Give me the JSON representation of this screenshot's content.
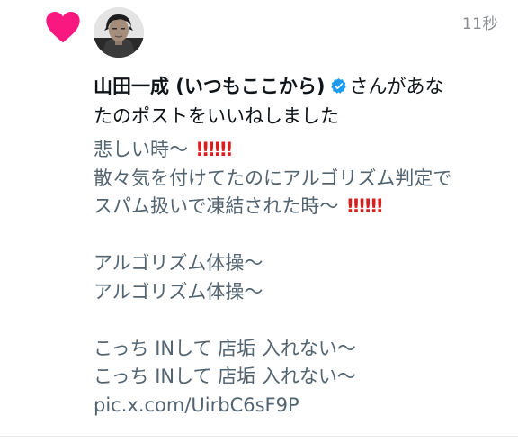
{
  "notification": {
    "timestamp": "11秒",
    "user_name": "山田一成 (いつもここから)",
    "action_text_1": "さんがあな",
    "action_text_2": "たのポストをいいねしました"
  },
  "tweet": {
    "line_1": "悲しい時〜",
    "line_2": "散々気を付けてたのにアルゴリズム判定で",
    "line_3": "スパム扱いで凍結された時〜",
    "line_5": "アルゴリズム体操〜",
    "line_6": "アルゴリズム体操〜",
    "line_8": "こっち INして 店垢 入れない〜",
    "line_9": "こっち INして 店垢 入れない〜",
    "link": "pic.x.com/UirbC6sF9P",
    "emoji": "‼"
  },
  "colors": {
    "like_heart": "#f91880",
    "verified_badge": "#1d9bf0",
    "text_primary": "#0f1419",
    "text_secondary": "#536471",
    "emoji_red": "#d81e1e"
  },
  "icons": {
    "like": "heart-icon",
    "verified": "verified-badge-icon",
    "avatar": "avatar"
  }
}
